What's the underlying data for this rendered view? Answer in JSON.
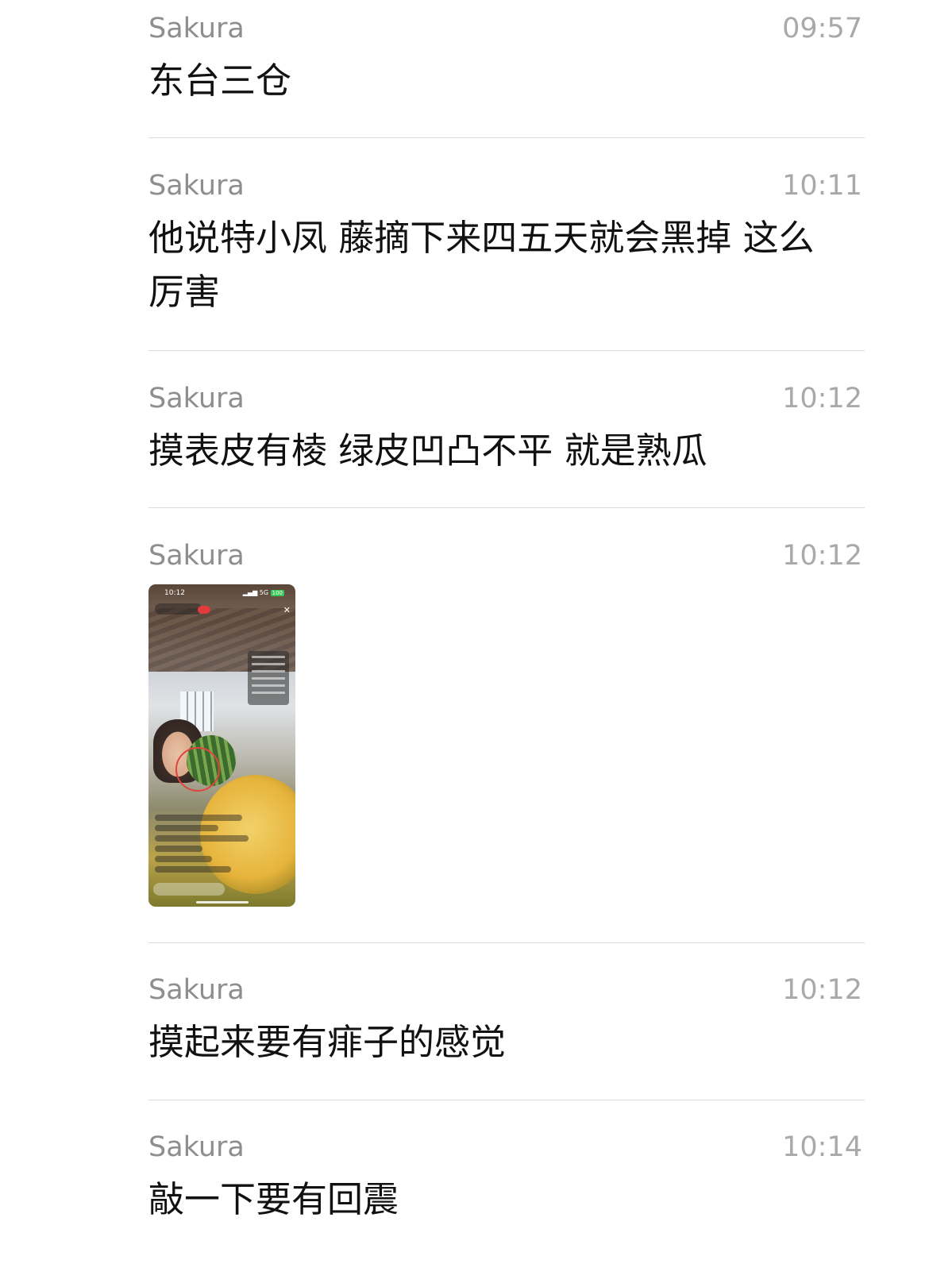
{
  "messages": [
    {
      "sender": "Sakura",
      "time": "09:57",
      "text": "东台三仓"
    },
    {
      "sender": "Sakura",
      "time": "10:11",
      "text": "他说特小凤 藤摘下来四五天就会黑掉 这么厉害"
    },
    {
      "sender": "Sakura",
      "time": "10:12",
      "text": "摸表皮有棱 绿皮凹凸不平 就是熟瓜"
    },
    {
      "sender": "Sakura",
      "time": "10:12",
      "image": {
        "status_time": "10:12",
        "signal": "5G",
        "battery": "100"
      }
    },
    {
      "sender": "Sakura",
      "time": "10:12",
      "text": "摸起来要有痱子的感觉"
    },
    {
      "sender": "Sakura",
      "time": "10:14",
      "text": "敲一下要有回震"
    }
  ]
}
